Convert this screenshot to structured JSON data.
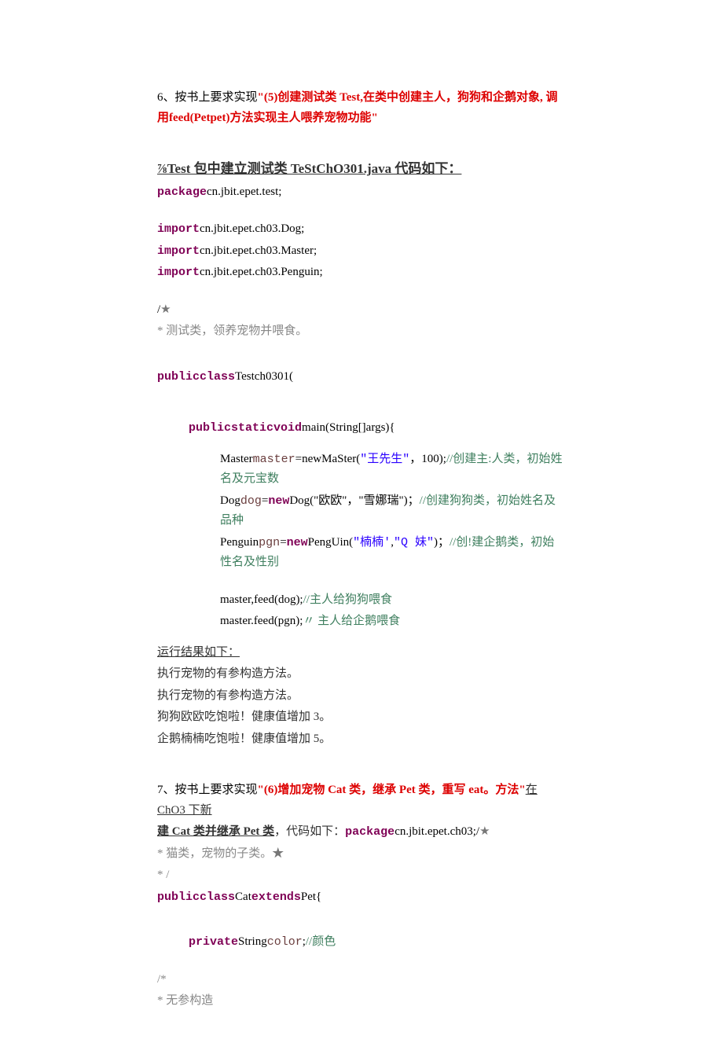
{
  "section6": {
    "prefix": "6、按书上要求实现",
    "title_red": "\"(5)创建测试类 Test,在类中创建主人，狗狗和企鹅对象, 调用feed(Petpet)方法实现主人喂养宠物功能\"",
    "heading": "⅞Test 包中建立测试类 TeStChO301.java 代码如下：",
    "pkg_kw": "package",
    "pkg_val": "cn.jbit.epet.test;",
    "imp_kw": "import",
    "imp1": "cn.jbit.epet.ch03.Dog;",
    "imp2": "cn.jbit.epet.ch03.Master;",
    "imp3": "cn.jbit.epet.ch03.Penguin;",
    "slash_star": "/",
    "star_comment1": "*   测试类，领养宠物并喂食。",
    "public_class": "publicclass",
    "class_name": "Testch0301(",
    "psvm_kw": "publicstaticvoid",
    "psvm_sig": "main(String[]args){",
    "line_master_pre": "Master",
    "line_master_var": "master",
    "line_master_eq_new": "=new",
    "line_master_ctor": "MaSter(",
    "line_master_str": "\"王先生\"",
    "line_master_rest": "，100);",
    "line_master_comment": "//创建主:人类，初始姓名及元宝数",
    "line_dog_pre": "Dog",
    "line_dog_var": "dog",
    "line_dog_eq": "=",
    "line_dog_new": "new",
    "line_dog_ctor": "Dog(\"欧欧\"，\"雪娜瑞\")；",
    "line_dog_comment": "//创建狗狗类，初始姓名及品种",
    "line_pgn_pre": "Penguin",
    "line_pgn_var": "pgn",
    "line_pgn_eq": "=",
    "line_pgn_new": "new",
    "line_pgn_ctor": "PengUin(",
    "line_pgn_str1": "\"楠楠'",
    "line_pgn_comma": ",",
    "line_pgn_str2": "\"Q 妹\"",
    "line_pgn_close": ")；",
    "line_pgn_comment": "//创!建企鹅类，初始性名及性别",
    "feed_dog": "master,feed(dog);",
    "feed_dog_comment": "//主人给狗狗喂食",
    "feed_pgn": "master.feed(pgn);",
    "feed_pgn_comment": "〃 主人给企鹅喂食",
    "result_heading": "运行结果如下：",
    "r1": "执行宠物的有参构造方法。",
    "r2": "执行宠物的有参构造方法。",
    "r3": "狗狗欧欧吃饱啦！健康值增加 3。",
    "r4": "企鹅楠楠吃饱啦！健康值增加 5。"
  },
  "section7": {
    "prefix": "7、按书上要求实现",
    "title_red": "\"(6)增加宠物 Cat 类，继承 Pet 类，重写 eat。方法\"",
    "heading_u1": "在 ChO3 下新",
    "heading_u2": "建 Cat 类并继承 Pet 类",
    "heading_plain": "，代码如下：",
    "pkg_kw": "package",
    "pkg_val": "cn.jbit.epet.ch03;",
    "slash_star": "/",
    "star_comment1": "*   猫类，宠物的子类。",
    "star_slash": "*   /",
    "public_class": "publicclass",
    "class_mid": "Cat",
    "extends_kw": "extends",
    "class_end": "Pet{",
    "private_kw": "private",
    "string_type": "String",
    "color_var": "color",
    "semi": ";",
    "color_comment": "//颜色",
    "star_comment2": "/*",
    "star_comment3": "*   无参构造"
  }
}
